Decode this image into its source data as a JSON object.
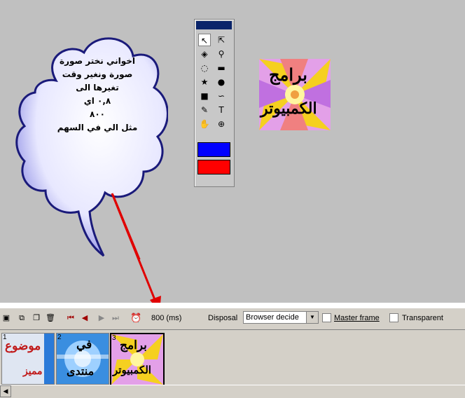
{
  "cloud": {
    "lines": [
      "اخواني نختر صورة",
      "صورة ونغير وقت",
      "تغيرها الى",
      "٠,٨ اي",
      "٨٠٠",
      "مثل الي في السهم"
    ]
  },
  "tools": {
    "items": [
      {
        "icon": "pointer-icon",
        "glyph": "↖"
      },
      {
        "icon": "subselect-icon",
        "glyph": "⇱"
      },
      {
        "icon": "paint-bucket-icon",
        "glyph": "◈"
      },
      {
        "icon": "eyedropper-icon",
        "glyph": "⚲"
      },
      {
        "icon": "marquee-icon",
        "glyph": "◌"
      },
      {
        "icon": "rectangle-icon",
        "glyph": "▬"
      },
      {
        "icon": "star-icon",
        "glyph": "★"
      },
      {
        "icon": "ellipse-icon",
        "glyph": "●"
      },
      {
        "icon": "rounded-rect-icon",
        "glyph": "■"
      },
      {
        "icon": "path-icon",
        "glyph": "∽"
      },
      {
        "icon": "pencil-icon",
        "glyph": "✎"
      },
      {
        "icon": "text-icon",
        "glyph": "T"
      },
      {
        "icon": "hand-icon",
        "glyph": "✋"
      },
      {
        "icon": "zoom-icon",
        "glyph": "⊕"
      }
    ],
    "stroke_color": "#0000ff",
    "fill_color": "#ff0000"
  },
  "preview": {
    "line1": "برامج",
    "line2": "الكمبيوتر"
  },
  "toolbar": {
    "frame_delay": "800 (ms)",
    "disposal_label": "Disposal",
    "disposal_value": "Browser decide",
    "master_frame_label": "Master frame",
    "transparent_label": "Transparent"
  },
  "frames": [
    {
      "num": "1",
      "top": "موضوع",
      "bottom": "مميز"
    },
    {
      "num": "2",
      "top": "في",
      "bottom": "منتدى"
    },
    {
      "num": "3",
      "top": "برامج",
      "bottom": "الكمبيوتر"
    }
  ]
}
